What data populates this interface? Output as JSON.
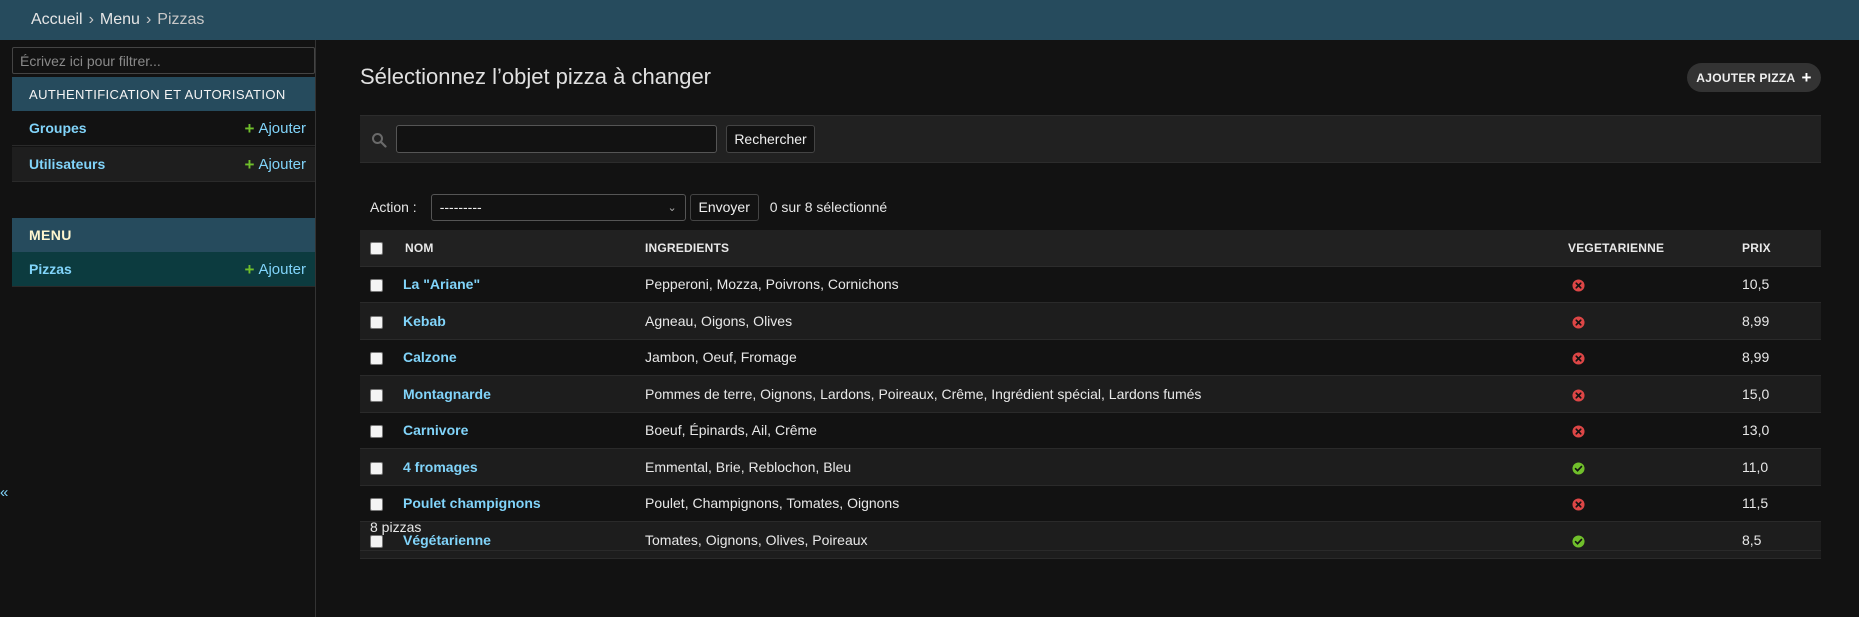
{
  "breadcrumbs": {
    "home": "Accueil",
    "app": "Menu",
    "current": "Pizzas",
    "separator": "›"
  },
  "sidebar": {
    "filter_placeholder": "Écrivez ici pour filtrer...",
    "modules": [
      {
        "caption": "Authentification et Autorisation",
        "models": [
          {
            "name": "Groupes",
            "add": "Ajouter"
          },
          {
            "name": "Utilisateurs",
            "add": "Ajouter"
          }
        ]
      },
      {
        "caption": "Menu",
        "models": [
          {
            "name": "Pizzas",
            "add": "Ajouter"
          }
        ]
      }
    ],
    "collapse_glyph": "«"
  },
  "main": {
    "title": "Sélectionnez l’objet pizza à changer",
    "add_button": "AJOUTER PIZZA",
    "search": {
      "value": "",
      "button": "Rechercher"
    },
    "actions": {
      "label": "Action :",
      "selected": "---------",
      "go": "Envoyer",
      "counter": "0 sur 8 sélectionné"
    },
    "table": {
      "headers": [
        "Nom",
        "Ingredients",
        "Vegetarienne",
        "Prix"
      ],
      "rows": [
        {
          "nom": "La \"Ariane\"",
          "ingredients": "Pepperoni, Mozza, Poivrons, Cornichons",
          "vegetarienne": false,
          "prix": "10,5"
        },
        {
          "nom": "Kebab",
          "ingredients": "Agneau, Oigons, Olives",
          "vegetarienne": false,
          "prix": "8,99"
        },
        {
          "nom": "Calzone",
          "ingredients": "Jambon, Oeuf, Fromage",
          "vegetarienne": false,
          "prix": "8,99"
        },
        {
          "nom": "Montagnarde",
          "ingredients": "Pommes de terre, Oignons, Lardons, Poireaux, Crême, Ingrédient spécial, Lardons fumés",
          "vegetarienne": false,
          "prix": "15,0"
        },
        {
          "nom": "Carnivore",
          "ingredients": "Boeuf, Épinards, Ail, Crême",
          "vegetarienne": false,
          "prix": "13,0"
        },
        {
          "nom": "4 fromages",
          "ingredients": "Emmental, Brie, Reblochon, Bleu",
          "vegetarienne": true,
          "prix": "11,0"
        },
        {
          "nom": "Poulet champignons",
          "ingredients": "Poulet, Champignons, Tomates, Oignons",
          "vegetarienne": false,
          "prix": "11,5"
        },
        {
          "nom": "Végétarienne",
          "ingredients": "Tomates, Oignons, Olives, Poireaux",
          "vegetarienne": true,
          "prix": "8,5"
        }
      ]
    },
    "paginator": "8 pizzas"
  },
  "colors": {
    "header_bg": "#264b5d",
    "link": "#81d4fa",
    "add_green": "#70bf2b",
    "yes_green": "#70bf2b",
    "no_red": "#dd4646"
  },
  "icons": {
    "search": "search-icon",
    "yes": "check-circle-icon",
    "no": "x-circle-icon",
    "add": "plus-icon"
  }
}
